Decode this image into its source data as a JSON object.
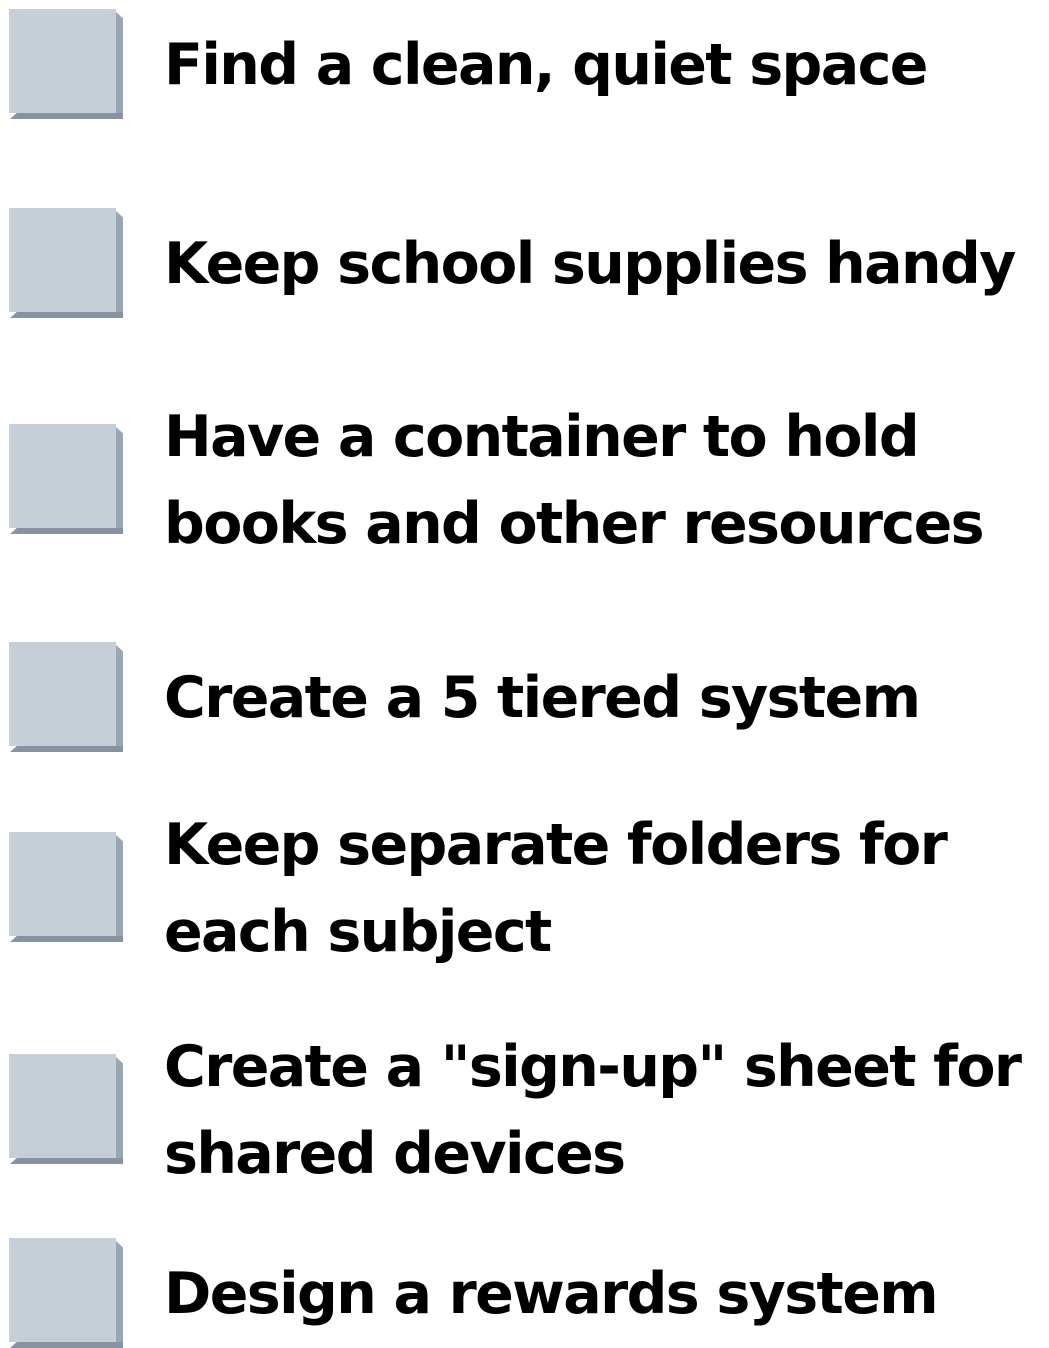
{
  "checklist": {
    "items": [
      {
        "label": "Find a clean, quiet space"
      },
      {
        "label": "Keep school supplies handy"
      },
      {
        "label": "Have a container to hold\nbooks and other resources"
      },
      {
        "label": "Create a 5 tiered system"
      },
      {
        "label": "Keep separate folders for\neach subject"
      },
      {
        "label": "Create a \"sign-up\" sheet for\nshared devices"
      },
      {
        "label": "Design a rewards system"
      }
    ]
  },
  "colors": {
    "checkbox_face": "#c6ced7",
    "checkbox_shadow": "#8793a0",
    "text": "#000000"
  }
}
